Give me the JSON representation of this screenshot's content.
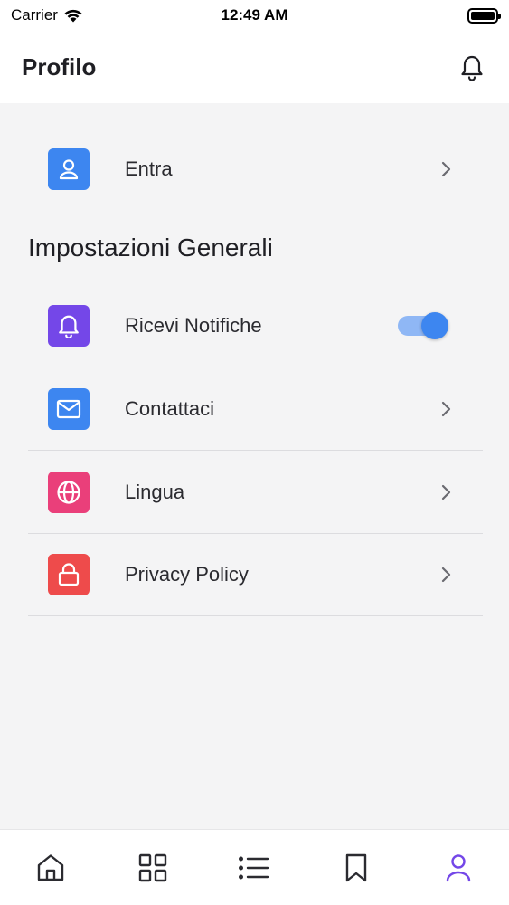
{
  "status_bar": {
    "carrier": "Carrier",
    "time": "12:49 AM"
  },
  "header": {
    "title": "Profilo",
    "bell_icon": "bell-icon"
  },
  "login": {
    "label": "Entra",
    "icon": "user-icon",
    "color": "#3d86f0"
  },
  "section": {
    "title": "Impostazioni Generali"
  },
  "settings": [
    {
      "label": "Ricevi Notifiche",
      "icon": "bell-icon",
      "color": "#7447e8",
      "toggle": true,
      "toggle_on": true
    },
    {
      "label": "Contattaci",
      "icon": "mail-icon",
      "color": "#3d86f0"
    },
    {
      "label": "Lingua",
      "icon": "globe-icon",
      "color": "#ea3f7a"
    },
    {
      "label": "Privacy Policy",
      "icon": "lock-icon",
      "color": "#ee4b4b"
    }
  ],
  "tab_bar": {
    "items": [
      {
        "name": "home",
        "icon": "home-icon"
      },
      {
        "name": "grid",
        "icon": "grid-icon"
      },
      {
        "name": "list",
        "icon": "list-icon"
      },
      {
        "name": "bookmark",
        "icon": "bookmark-icon"
      },
      {
        "name": "profile",
        "icon": "user-icon",
        "active": true
      }
    ],
    "active_color": "#7447e8",
    "inactive_color": "#2b2b30"
  }
}
